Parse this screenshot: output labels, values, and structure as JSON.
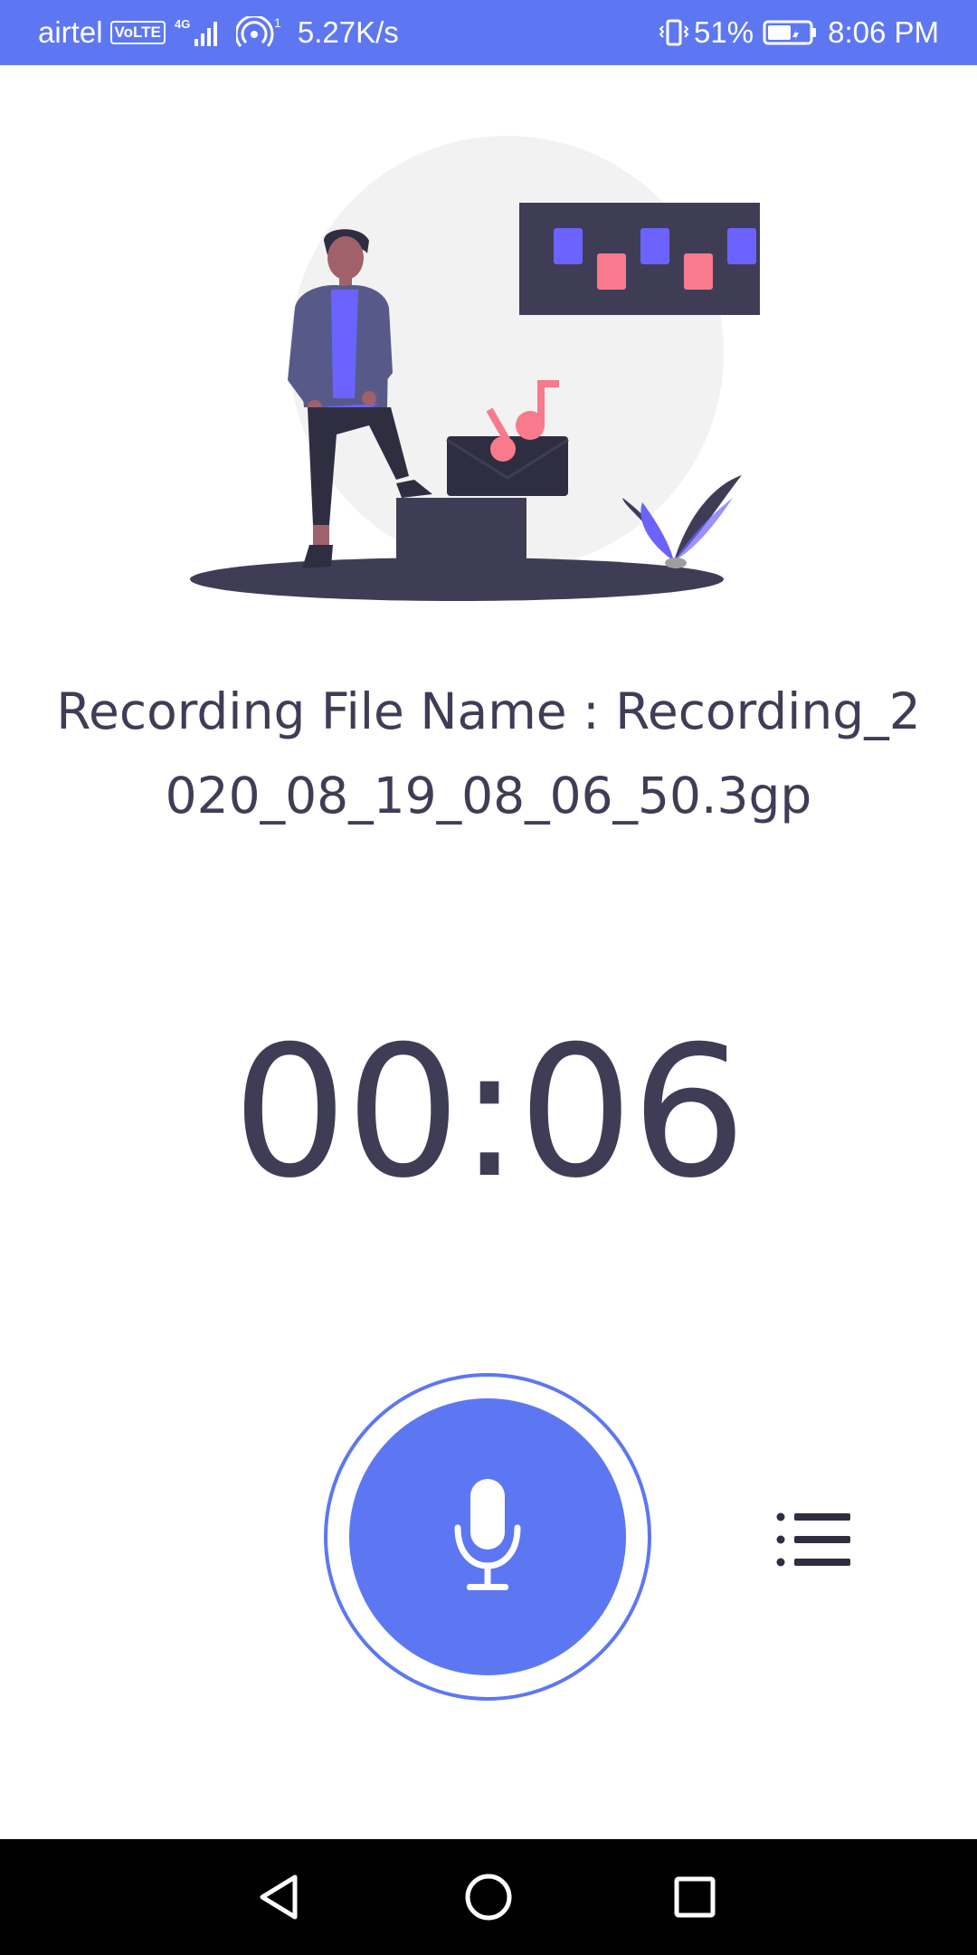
{
  "status_bar": {
    "background": "#5d77f3",
    "carrier": "airtel",
    "volte": "VoLTE",
    "network": "4G",
    "hotspot_count": "1",
    "speed": "5.27K/s",
    "battery_percent": "51%",
    "time": "8:06 PM"
  },
  "recording": {
    "file_name": "Recording File Name : Recording_2020_08_19_08_06_50.3gp",
    "timer": "00:06"
  },
  "colors": {
    "accent": "#5d77f3",
    "text_dark": "#3f3d56",
    "illustration_purple": "#6c63ff",
    "illustration_pink": "#f87a8c",
    "illustration_bg": "#f2f2f2"
  },
  "icons": {
    "record": "microphone-icon",
    "recordings_list": "list-icon",
    "nav_back": "triangle-back-icon",
    "nav_home": "circle-home-icon",
    "nav_recents": "square-recents-icon"
  }
}
